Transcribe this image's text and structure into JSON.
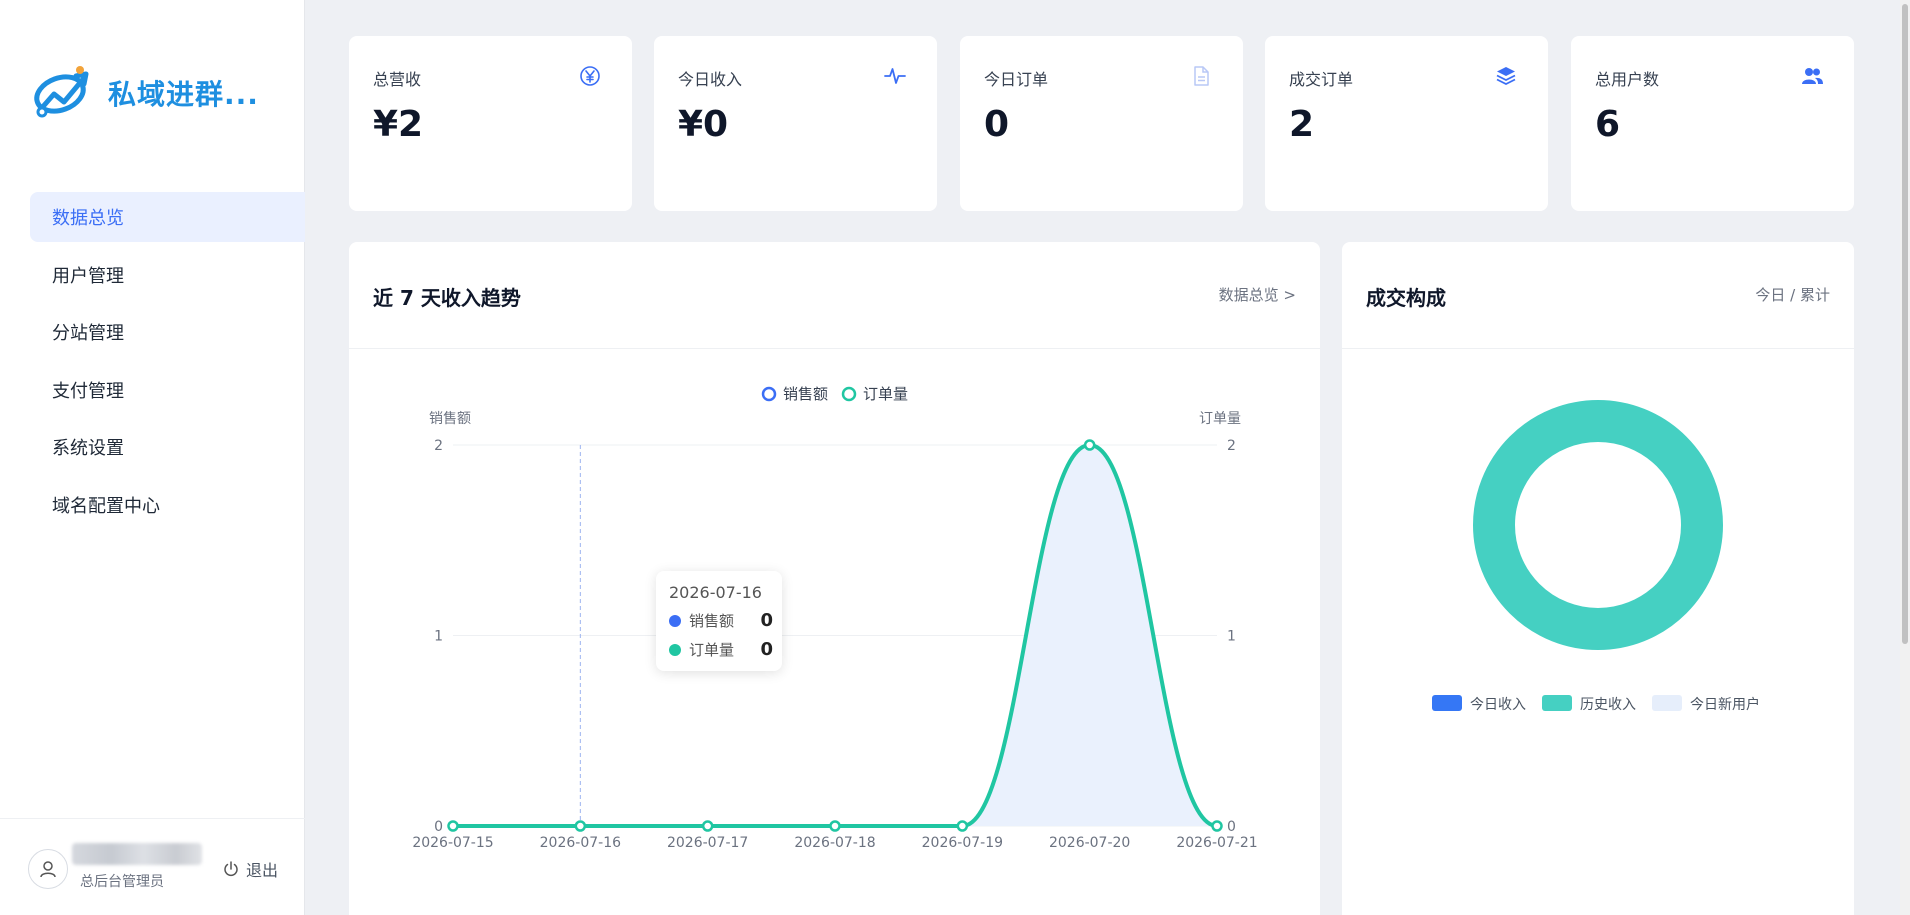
{
  "app": {
    "title": "私域进群..."
  },
  "sidebar": {
    "items": [
      {
        "label": "数据总览",
        "active": true
      },
      {
        "label": "用户管理"
      },
      {
        "label": "分站管理"
      },
      {
        "label": "支付管理"
      },
      {
        "label": "系统设置"
      },
      {
        "label": "域名配置中心"
      }
    ],
    "user": {
      "role": "总后台管理员",
      "logout_label": "退出"
    }
  },
  "stats": [
    {
      "label": "总营收",
      "value": "¥2",
      "icon": "yen-icon"
    },
    {
      "label": "今日收入",
      "value": "¥0",
      "icon": "pulse-icon"
    },
    {
      "label": "今日订单",
      "value": "0",
      "icon": "document-icon"
    },
    {
      "label": "成交订单",
      "value": "2",
      "icon": "layers-icon"
    },
    {
      "label": "总用户数",
      "value": "6",
      "icon": "users-icon"
    }
  ],
  "trend_panel": {
    "title": "近 7 天收入趋势",
    "link": "数据总览 >"
  },
  "composition_panel": {
    "title": "成交构成",
    "toggle": "今日 / 累计"
  },
  "tooltip": {
    "date": "2026-07-16",
    "rows": [
      {
        "name": "销售额",
        "value": "0"
      },
      {
        "name": "订单量",
        "value": "0"
      }
    ]
  },
  "colors": {
    "accent": "#3b6ef5",
    "teal": "#20c6a2",
    "brand": "#1e8fe0"
  },
  "chart_data": [
    {
      "type": "line",
      "x": [
        "2026-07-15",
        "2026-07-16",
        "2026-07-17",
        "2026-07-18",
        "2026-07-19",
        "2026-07-20",
        "2026-07-21"
      ],
      "series": [
        {
          "name": "销售额",
          "values": [
            0,
            0,
            0,
            0,
            0,
            2,
            0
          ],
          "color": "#3b6ef5",
          "axis": "left"
        },
        {
          "name": "订单量",
          "values": [
            0,
            0,
            0,
            0,
            0,
            2,
            0
          ],
          "color": "#20c6a2",
          "axis": "right"
        }
      ],
      "ylabel": "销售额",
      "y2label": "订单量",
      "ylim": [
        0,
        2
      ],
      "y2lim": [
        0,
        2
      ],
      "yticks": [
        0,
        1,
        2
      ],
      "legend": "top-center",
      "smooth": true,
      "area_fill": true
    },
    {
      "type": "pie",
      "donut": true,
      "labels": [
        "今日收入",
        "历史收入",
        "今日新用户"
      ],
      "values": [
        0,
        2,
        0
      ],
      "colors": [
        "#3577f5",
        "#45d0c2",
        "#e6eefb"
      ],
      "legend": "bottom-center"
    }
  ]
}
